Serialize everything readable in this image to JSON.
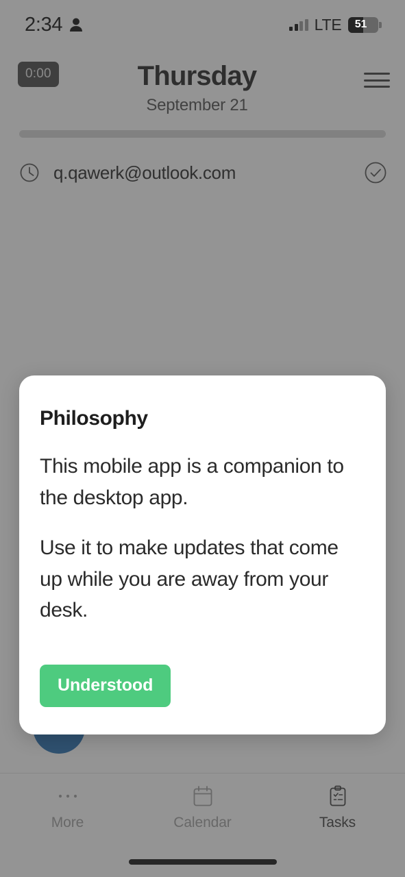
{
  "status_bar": {
    "time": "2:34",
    "person_icon": "person-icon",
    "network": "LTE",
    "battery_level": "51",
    "battery_percent": 51,
    "signal_icon": "signal-bars-icon"
  },
  "header": {
    "timer_badge": "0:00",
    "title": "Thursday",
    "subtitle": "September 21",
    "menu_icon": "hamburger-menu-icon"
  },
  "progress": {
    "percent": 0
  },
  "tasks": [
    {
      "leading_icon": "clock-icon",
      "title": "q.qawerk@outlook.com",
      "trailing_icon": "check-circle-icon"
    }
  ],
  "fab": {
    "label": "+",
    "color": "#1f6bb0"
  },
  "modal": {
    "title": "Philosophy",
    "paragraphs": [
      "This mobile app is a companion to the desktop app.",
      "Use it to make updates that come up while you are away from your desk."
    ],
    "primary_button": "Understood",
    "primary_button_color": "#4ecb7f"
  },
  "bottom_nav": {
    "items": [
      {
        "label": "More",
        "icon": "ellipsis-icon",
        "active": false
      },
      {
        "label": "Calendar",
        "icon": "calendar-icon",
        "active": false
      },
      {
        "label": "Tasks",
        "icon": "clipboard-checklist-icon",
        "active": true
      }
    ]
  }
}
